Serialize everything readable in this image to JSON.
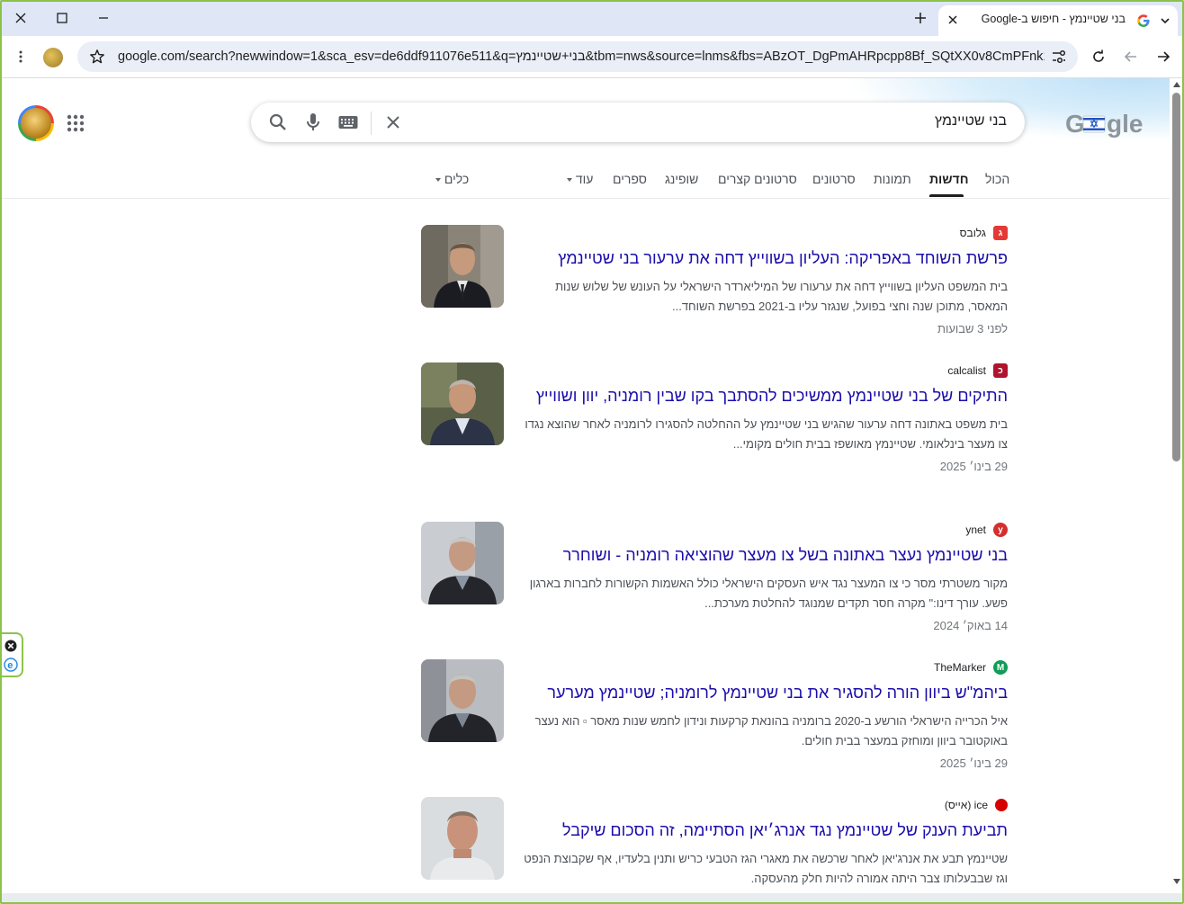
{
  "browser": {
    "tab_title": "בני שטיינמץ - חיפוש ב-Google",
    "url": "google.com/search?newwindow=1&sca_esv=de6ddf911076e511&q=בני+שטיינמץ&tbm=nws&source=lnms&fbs=ABzOT_DgPmAHRpcpp8Bf_SQtXX0v8CmPFnk14cy..."
  },
  "search": {
    "query": "בני שטיינמץ"
  },
  "nav": {
    "all": "הכול",
    "news": "חדשות",
    "images": "תמונות",
    "videos": "סרטונים",
    "short_videos": "סרטונים קצרים",
    "shopping": "שופינג",
    "books": "ספרים",
    "more": "עוד",
    "tools": "כלים"
  },
  "results": [
    {
      "source": "גלובס",
      "favicon_color": "#e53935",
      "favicon_letter": "ג",
      "title": "פרשת השוחד באפריקה: העליון בשווייץ דחה את ערעור בני שטיינמץ",
      "snippet": "בית המשפט העליון בשווייץ דחה את ערעורו של המיליארדר הישראלי על העונש של שלוש שנות המאסר, מתוכן שנה וחצי בפועל, שנגזר עליו ב-2021 בפרשת השוחד...",
      "date": "לפני 3 שבועות"
    },
    {
      "source": "calcalist",
      "favicon_color": "#b0132d",
      "favicon_letter": "כ",
      "title": "התיקים של בני שטיינמץ ממשיכים להסתבך בקו שבין רומניה, יוון ושווייץ",
      "snippet": "בית משפט באתונה דחה ערעור שהגיש בני שטיינמץ על ההחלטה להסגירו לרומניה לאחר שהוצא נגדו צו מעצר בינלאומי. שטיינמץ מאושפז בבית חולים מקומי...",
      "date": "29 בינו׳ 2025"
    },
    {
      "source": "ynet",
      "favicon_color": "#d32f2f",
      "favicon_letter": "y",
      "title": "בני שטיינמץ נעצר באתונה בשל צו מעצר שהוציאה רומניה - ושוחרר",
      "snippet": "מקור משטרתי מסר כי צו המעצר נגד איש העסקים הישראלי כולל האשמות הקשורות לחברות בארגון פשע. עורך דינו:\" מקרה חסר תקדים שמנוגד להחלטת מערכת...",
      "date": "14 באוק׳ 2024"
    },
    {
      "source": "TheMarker",
      "favicon_color": "#0f9d58",
      "favicon_letter": "M",
      "title": "ביהמ\"ש ביוון הורה להסגיר את בני שטיינמץ לרומניה; שטיינמץ מערער",
      "snippet": "איל הכרייה הישראלי הורשע ב-2020 ברומניה בהונאת קרקעות ונידון לחמש שנות מאסר ▫ הוא נעצר באוקטובר ביוון ומוחזק במעצר בבית חולים.",
      "date": "29 בינו׳ 2025"
    },
    {
      "source": "ice (אייס)",
      "favicon_color": "#d50000",
      "favicon_letter": "",
      "title": "תביעת הענק של שטיינמץ נגד אנרג׳יאן הסתיימה, זה הסכום שיקבל",
      "snippet": "שטיינמץ תבע את אנרג'יאן לאחר שרכשה את מאגרי הגז הטבעי כריש ותנין בלעדיו, אף שקבוצת הנפט וגז שבבעלותו צבר היתה אמורה להיות חלק מהעסקה.",
      "date": ""
    }
  ],
  "colors": {
    "link": "#1a0dab",
    "frame_accent": "#8bc34a",
    "tabstrip": "#dfe7f6"
  }
}
